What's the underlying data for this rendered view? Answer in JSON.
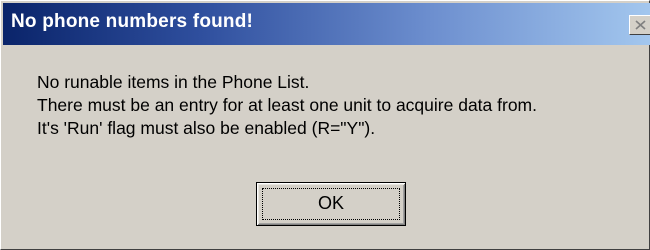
{
  "dialog": {
    "title": "No phone numbers found!",
    "close_icon": "close-icon",
    "message_lines": [
      "No runable items in the Phone List.",
      "There must be an entry for at least one unit to acquire data from.",
      "It's 'Run' flag must also be enabled (R=\"Y\")."
    ],
    "ok_label": "OK"
  },
  "colors": {
    "dialog_face": "#d4d0c8",
    "titlebar_start": "#0a246a",
    "titlebar_end": "#a6caf0",
    "title_text": "#ffffff"
  }
}
